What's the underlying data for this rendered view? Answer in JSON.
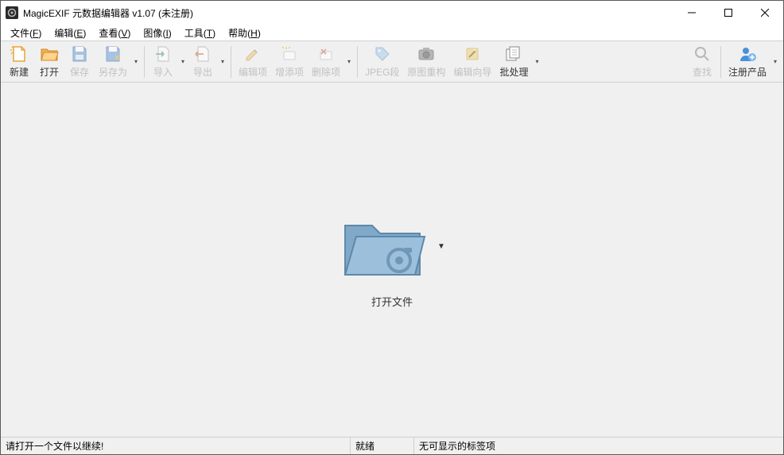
{
  "titlebar": {
    "title": "MagicEXIF 元数据编辑器 v1.07 (未注册)"
  },
  "menu": {
    "file": {
      "label": "文件",
      "mn": "F"
    },
    "edit": {
      "label": "编辑",
      "mn": "E"
    },
    "view": {
      "label": "查看",
      "mn": "V"
    },
    "image": {
      "label": "图像",
      "mn": "I"
    },
    "tools": {
      "label": "工具",
      "mn": "T"
    },
    "help": {
      "label": "帮助",
      "mn": "H"
    }
  },
  "toolbar": {
    "new": "新建",
    "open": "打开",
    "save": "保存",
    "saveas": "另存为",
    "import": "导入",
    "export": "导出",
    "editItem": "编辑项",
    "addItem": "增添项",
    "delItem": "删除项",
    "jpeg": "JPEG段",
    "rebuild": "原图重构",
    "wizard": "编辑向导",
    "batch": "批处理",
    "find": "查找",
    "register": "注册产品"
  },
  "main": {
    "openFile": "打开文件"
  },
  "status": {
    "left": "请打开一个文件以继续!",
    "center": "就绪",
    "right": "无可显示的标签项"
  }
}
